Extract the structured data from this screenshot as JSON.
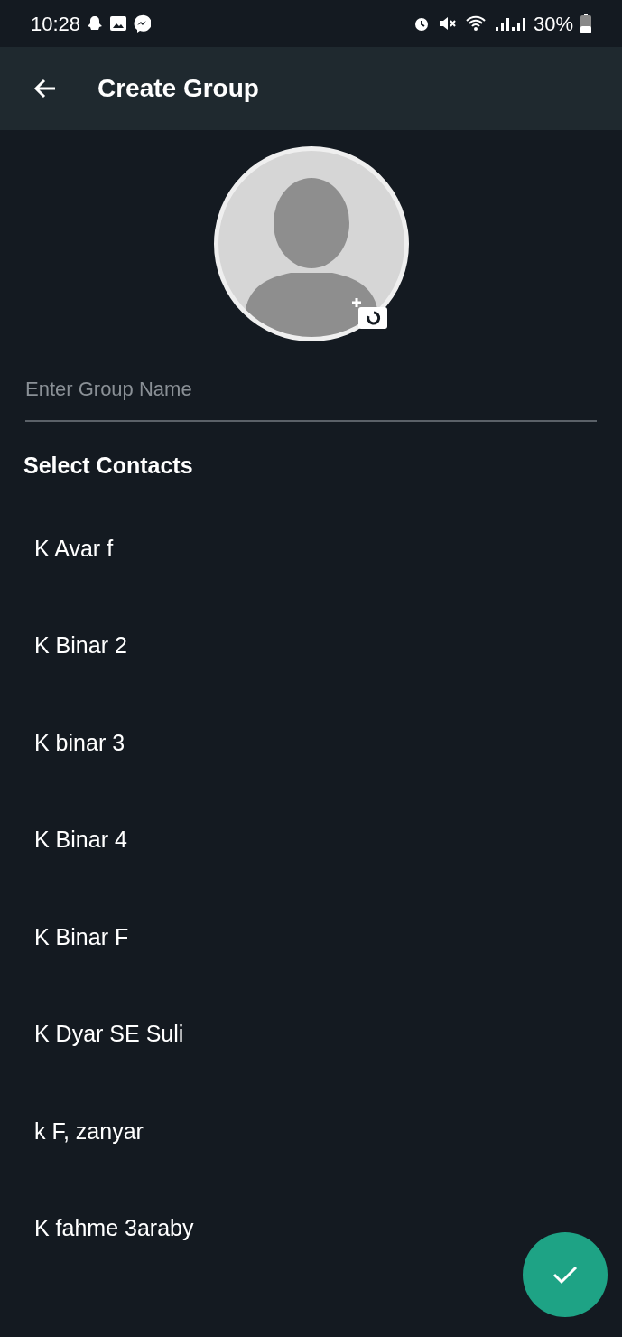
{
  "status_bar": {
    "time": "10:28",
    "battery": "30%"
  },
  "app_bar": {
    "title": "Create Group"
  },
  "group_name": {
    "placeholder": "Enter Group Name"
  },
  "section_title": "Select Contacts",
  "contacts": [
    {
      "name": "K Avar f"
    },
    {
      "name": "K Binar 2"
    },
    {
      "name": "K binar 3"
    },
    {
      "name": "K Binar 4"
    },
    {
      "name": "K Binar F"
    },
    {
      "name": "K Dyar SE Suli"
    },
    {
      "name": "k F, zanyar"
    },
    {
      "name": "K fahme 3araby"
    }
  ]
}
